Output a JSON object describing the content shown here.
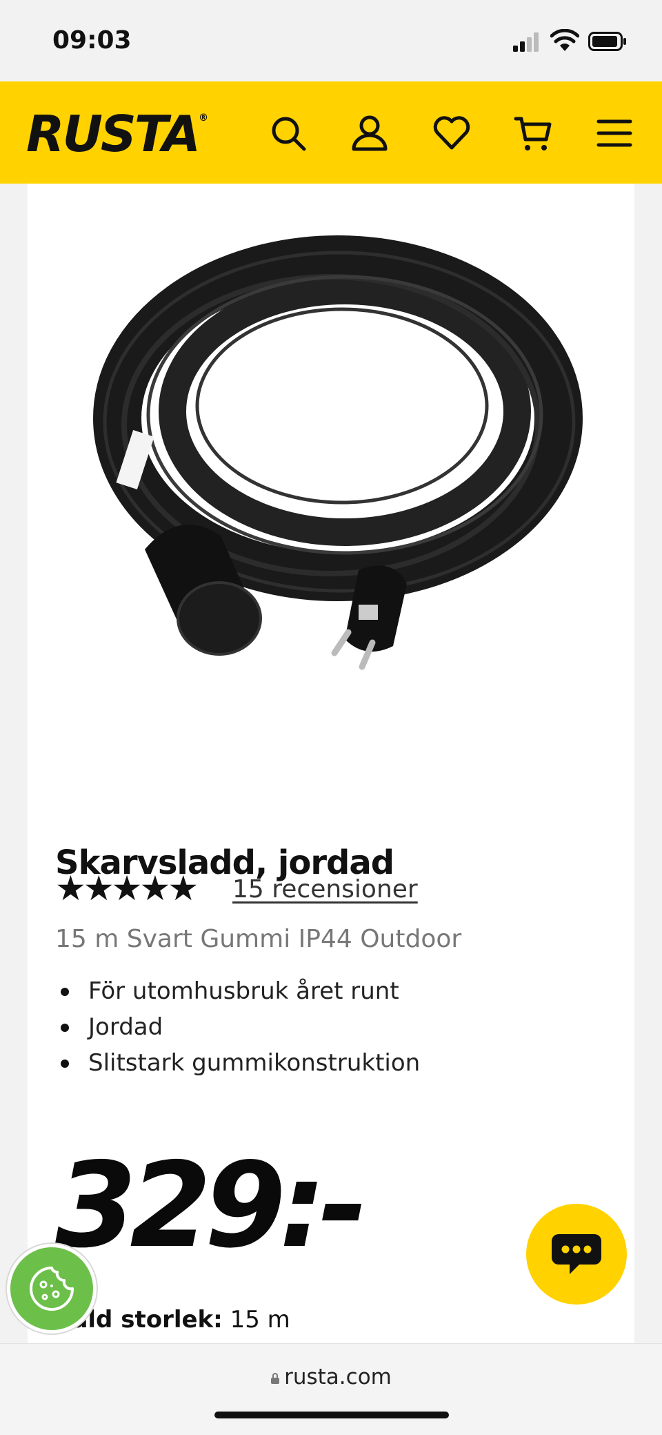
{
  "status_bar": {
    "time": "09:03"
  },
  "header": {
    "brand": "RUSTA",
    "brand_mark": "®"
  },
  "product": {
    "title": "Skarvsladd, jordad",
    "rating": {
      "stars": 5,
      "max": 5,
      "reviews_label": "15 recensioner"
    },
    "subtitle": "15 m Svart Gummi IP44 Outdoor",
    "features": [
      "För utomhusbruk året runt",
      "Jordad",
      "Slitstark gummikonstruktion"
    ],
    "price": "329:-",
    "size": {
      "label": "Vald storlek:",
      "value": "15 m"
    }
  },
  "browser": {
    "url": "rusta.com"
  },
  "colors": {
    "brand_yellow": "#ffd200",
    "cookie_green": "#6cc04a",
    "text": "#111111"
  },
  "icons": {
    "header": [
      "search-icon",
      "user-icon",
      "heart-icon",
      "cart-icon",
      "menu-icon"
    ],
    "floating": [
      "chat-icon",
      "cookie-icon"
    ]
  }
}
